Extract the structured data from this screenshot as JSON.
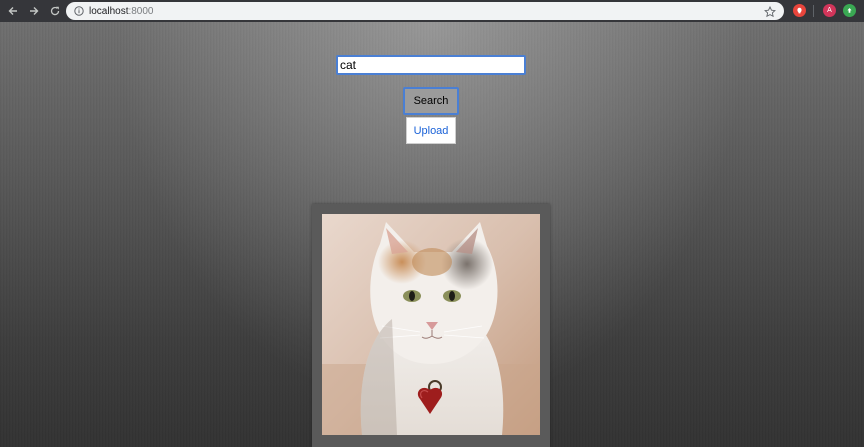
{
  "browser": {
    "url_host": "localhost",
    "url_port": ":8000",
    "icons": {
      "back": "arrow-left-icon",
      "forward": "arrow-right-icon",
      "reload": "reload-icon",
      "info": "info-icon",
      "bookmark": "star-icon"
    },
    "extensions": [
      {
        "name": "red-extension-icon",
        "color": "#e8453c",
        "label": ""
      },
      {
        "name": "avatar-icon",
        "color": "#d2355a",
        "label": "A"
      },
      {
        "name": "green-extension-icon",
        "color": "#3aa853",
        "label": ""
      }
    ]
  },
  "search": {
    "value": "cat",
    "button_label": "Search"
  },
  "upload": {
    "label": "Upload"
  },
  "result": {
    "image_subject": "cat-photo"
  },
  "colors": {
    "focus_border": "#4a7fd4",
    "link_blue": "#1a62d8",
    "search_button_bg": "#9b9b9b"
  }
}
